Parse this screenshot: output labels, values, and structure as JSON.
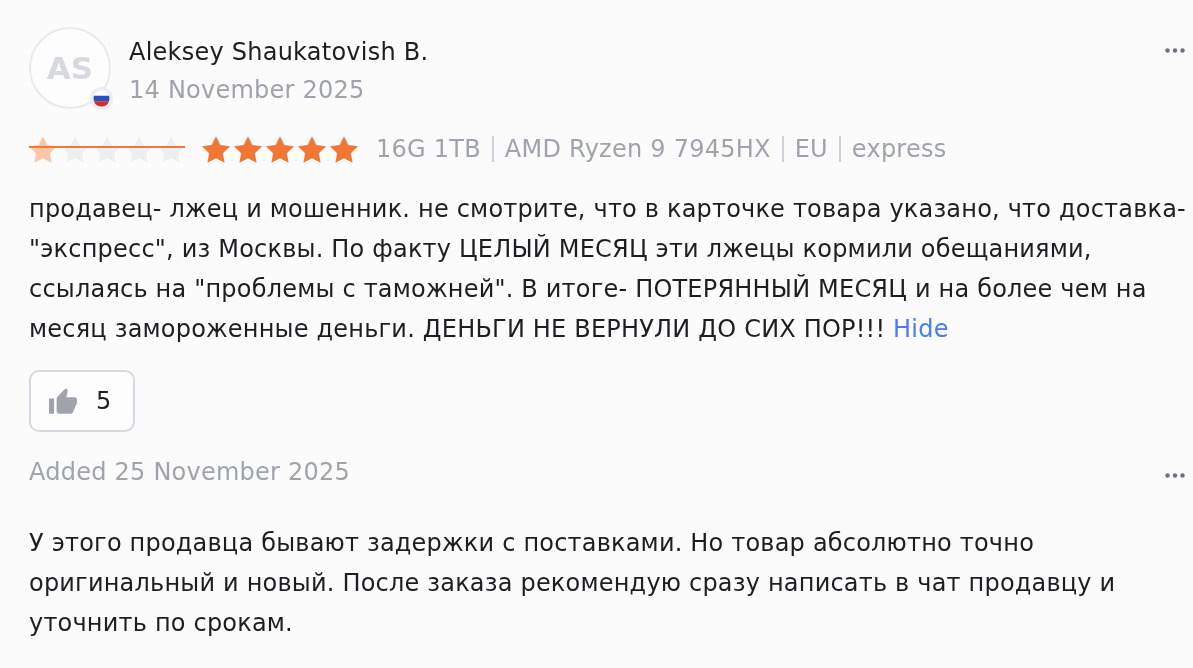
{
  "review": {
    "avatar_initials": "AS",
    "author": "Aleksey Shaukatovish B.",
    "date": "14 November 2025",
    "previous_rating": {
      "stars": 1,
      "struck_out": true
    },
    "rating": {
      "stars": 5
    },
    "variant": [
      "16G 1TB",
      "AMD Ryzen 9 7945HX",
      "EU",
      "express"
    ],
    "text": "продавец- лжец и мошенник. не смотрите, что в карточке товара указано, что доставка- \"экспресс\", из Москвы. По факту ЦЕЛЫЙ МЕСЯЦ эти лжецы кормили обещаниями, ссылаясь на \"проблемы с таможней\". В итоге- ПОТЕРЯННЫЙ МЕСЯЦ и на более чем на месяц замороженные деньги. ДЕНЬГИ НЕ ВЕРНУЛИ ДО СИХ ПОР!!!",
    "hide_link": "Hide",
    "likes": "5",
    "addendum": {
      "label": "Added 25 November 2025",
      "text": "У этого продавца бывают задержки с поставками. Но товар абсолютно точно оригинальный и новый. После заказа рекомендую сразу написать в чат продавцу и уточнить по срокам."
    }
  }
}
